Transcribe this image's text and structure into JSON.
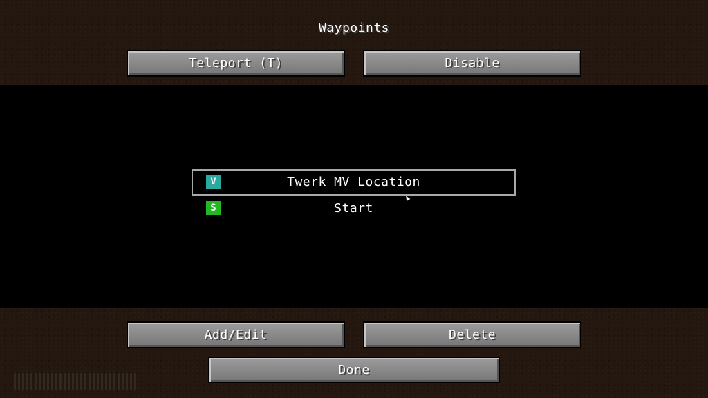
{
  "screen": {
    "title": "Waypoints"
  },
  "top_buttons": {
    "teleport_label": "Teleport (T)",
    "disable_label": "Disable"
  },
  "waypoints": [
    {
      "initial": "V",
      "name": "Twerk MV Location",
      "color": "#2aa9a0",
      "selected": true
    },
    {
      "initial": "S",
      "name": "Start",
      "color": "#22b822",
      "selected": false
    }
  ],
  "bottom_buttons": {
    "add_edit_label": "Add/Edit",
    "delete_label": "Delete",
    "done_label": "Done"
  }
}
